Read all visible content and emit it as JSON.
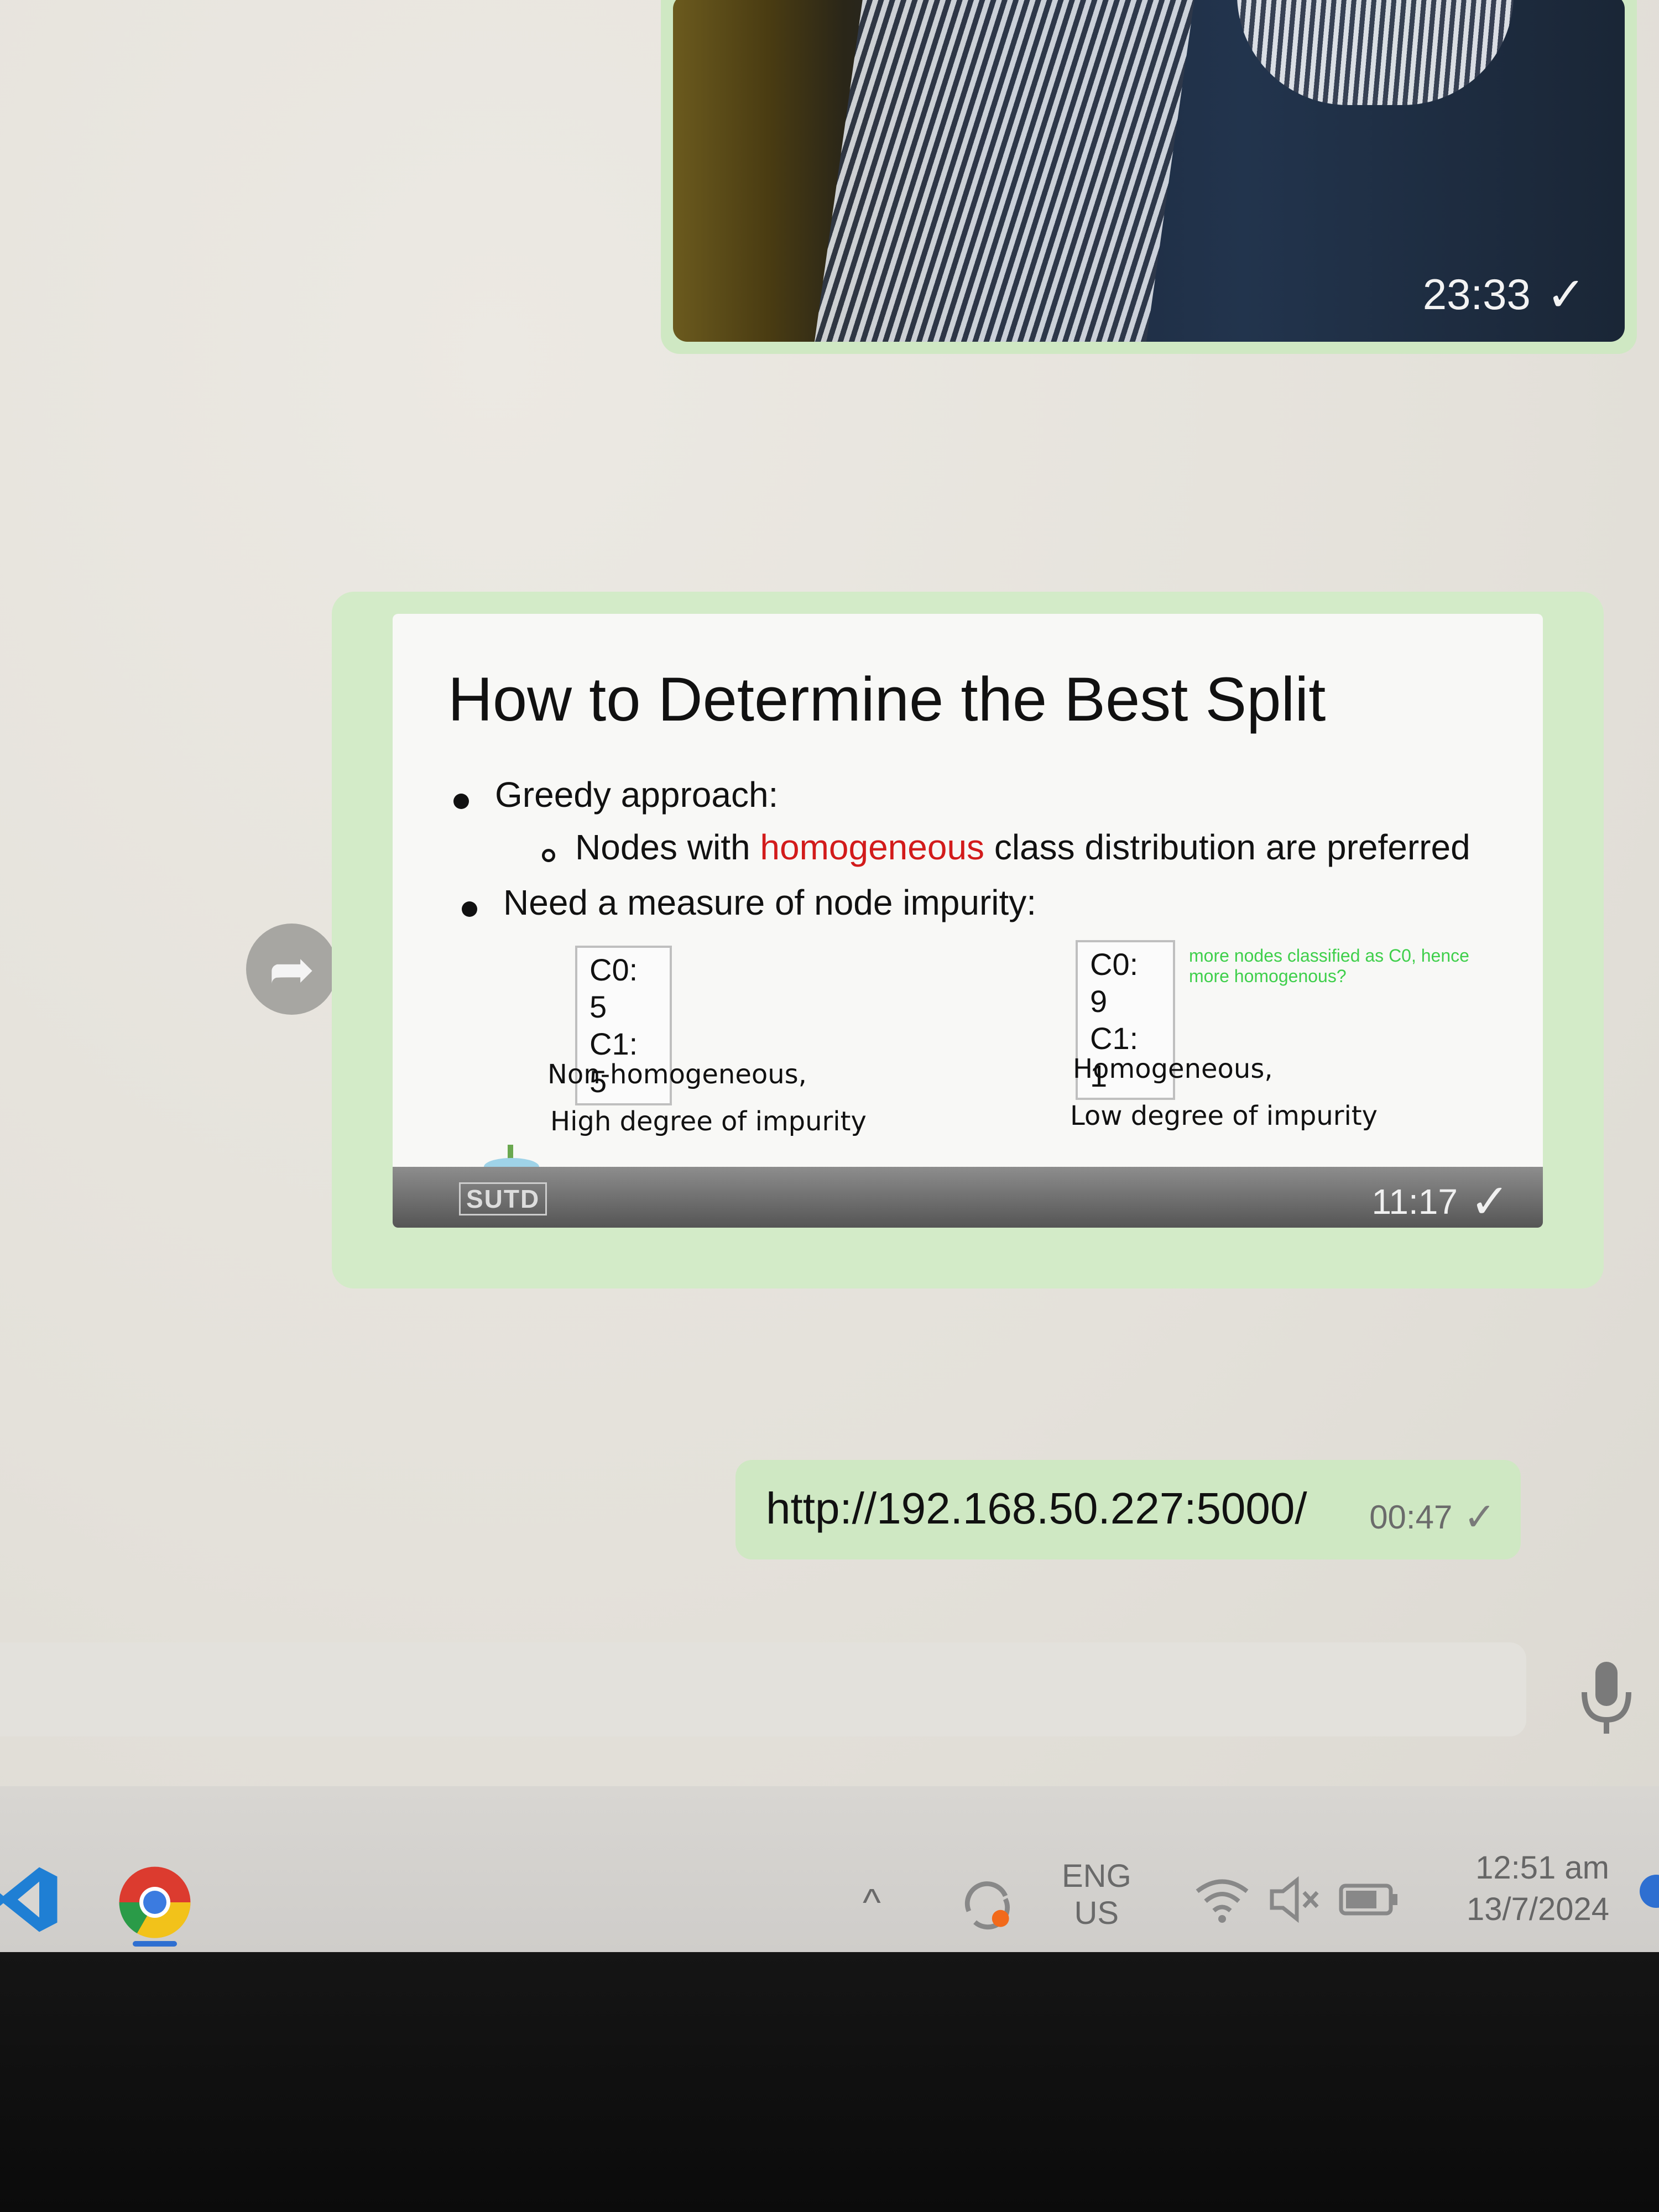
{
  "top_photo": {
    "time": "23:33",
    "status_icon": "check-icon"
  },
  "slide_message": {
    "title": "How to Determine the Best Split",
    "bullet1": "Greedy approach:",
    "sub_bullet_pre": "Nodes with ",
    "sub_bullet_highlight": "homogeneous",
    "sub_bullet_post": " class distribution are preferred",
    "bullet2": "Need a measure of node impurity:",
    "left_box": {
      "line1": "C0: 5",
      "line2": "C1: 5"
    },
    "left_caption1": "Non-homogeneous,",
    "left_caption2": "High degree of impurity",
    "right_box": {
      "line1": "C0: 9",
      "line2": "C1: 1"
    },
    "right_caption1": "Homogeneous,",
    "right_caption2": "Low degree of impurity",
    "annotation": "more nodes classified as C0, hence more homogenous?",
    "footer_logo": "SUTD",
    "time": "11:17",
    "highlight_color": "#d21b1b",
    "annotation_color": "#3fcf4b"
  },
  "link_message": {
    "text": "http://192.168.50.227:5000/",
    "time": "00:47"
  },
  "taskbar": {
    "language_line1": "ENG",
    "language_line2": "US",
    "clock_time": "12:51 am",
    "clock_date": "13/7/2024",
    "icons": [
      "vscode-icon",
      "chrome-icon",
      "chevron-up-icon",
      "sync-icon",
      "wifi-icon",
      "volume-muted-icon",
      "battery-icon"
    ]
  }
}
